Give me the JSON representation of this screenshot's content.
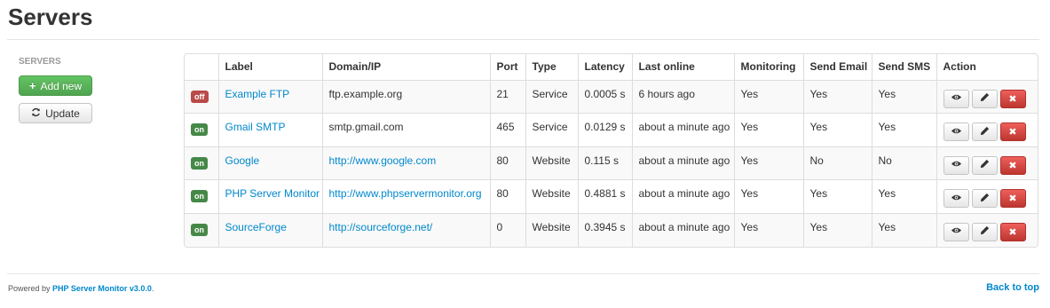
{
  "page": {
    "title": "Servers"
  },
  "sidebar": {
    "heading": "SERVERS",
    "add_new_label": "Add new",
    "update_label": "Update"
  },
  "table": {
    "headers": [
      "",
      "Label",
      "Domain/IP",
      "Port",
      "Type",
      "Latency",
      "Last online",
      "Monitoring",
      "Send Email",
      "Send SMS",
      "Action"
    ],
    "rows": [
      {
        "status": "off",
        "label": "Example FTP",
        "domain": "ftp.example.org",
        "domain_is_link": false,
        "port": "21",
        "type": "Service",
        "latency": "0.0005 s",
        "last_online": "6 hours ago",
        "monitoring": "Yes",
        "send_email": "Yes",
        "send_sms": "Yes"
      },
      {
        "status": "on",
        "label": "Gmail SMTP",
        "domain": "smtp.gmail.com",
        "domain_is_link": false,
        "port": "465",
        "type": "Service",
        "latency": "0.0129 s",
        "last_online": "about a minute ago",
        "monitoring": "Yes",
        "send_email": "Yes",
        "send_sms": "Yes"
      },
      {
        "status": "on",
        "label": "Google",
        "domain": "http://www.google.com",
        "domain_is_link": true,
        "port": "80",
        "type": "Website",
        "latency": "0.115 s",
        "last_online": "about a minute ago",
        "monitoring": "Yes",
        "send_email": "No",
        "send_sms": "No"
      },
      {
        "status": "on",
        "label": "PHP Server Monitor",
        "domain": "http://www.phpservermonitor.org",
        "domain_is_link": true,
        "port": "80",
        "type": "Website",
        "latency": "0.4881 s",
        "last_online": "about a minute ago",
        "monitoring": "Yes",
        "send_email": "Yes",
        "send_sms": "Yes"
      },
      {
        "status": "on",
        "label": "SourceForge",
        "domain": "http://sourceforge.net/",
        "domain_is_link": true,
        "port": "0",
        "type": "Website",
        "latency": "0.3945 s",
        "last_online": "about a minute ago",
        "monitoring": "Yes",
        "send_email": "Yes",
        "send_sms": "Yes"
      }
    ]
  },
  "footer": {
    "powered_by": "Powered by",
    "product_link": "PHP Server Monitor v3.0.0",
    "period": ".",
    "back_to_top": "Back to top"
  },
  "colors": {
    "link": "#0088cc",
    "status_on": "#468847",
    "status_off": "#b94a48",
    "success_button": "#51a351",
    "danger_button": "#bd362f"
  },
  "icons": {
    "add": "plus-icon",
    "update": "refresh-icon",
    "view": "eye-icon",
    "edit": "pencil-icon",
    "delete": "close-icon"
  }
}
